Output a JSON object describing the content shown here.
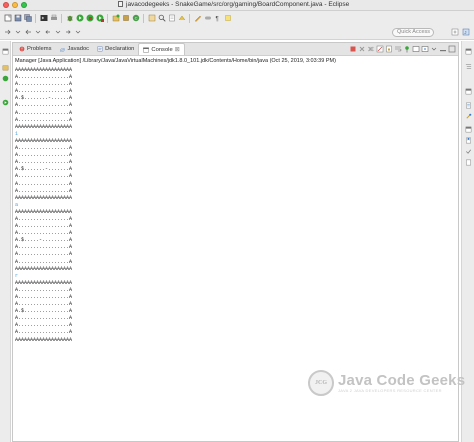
{
  "window": {
    "title": "javacodegeeks - SnakeGame/src/org/gaming/BoardComponent.java - Eclipse",
    "quick_access_placeholder": "Quick Access"
  },
  "tabs": [
    {
      "label": "Problems",
      "icon": "problems-icon"
    },
    {
      "label": "Javadoc",
      "icon": "javadoc-icon"
    },
    {
      "label": "Declaration",
      "icon": "declaration-icon"
    },
    {
      "label": "Console",
      "icon": "console-icon",
      "active": true,
      "close": "⊠"
    }
  ],
  "console": {
    "header": "Manager [Java Application] /Library/Java/JavaVirtualMachines/jdk1.8.0_101.jdk/Contents/Home/bin/java (Oct 25, 2019, 3:03:39 PM)",
    "lines": [
      "AAAAAAAAAAAAAAAAAAA",
      "A.................A",
      "A.................A",
      "A.................A",
      "A.$........-......A",
      "A.................A",
      "A.................A",
      "A.................A",
      "AAAAAAAAAAAAAAAAAAA",
      "1",
      "AAAAAAAAAAAAAAAAAAA",
      "A.................A",
      "A.................A",
      "A.................A",
      "A.$.......-.......A",
      "A.................A",
      "A.................A",
      "A.................A",
      "AAAAAAAAAAAAAAAAAAA",
      "a",
      "AAAAAAAAAAAAAAAAAAA",
      "A.................A",
      "A.................A",
      "A.................A",
      "A.$.....-.........A",
      "A.................A",
      "A.................A",
      "A.................A",
      "AAAAAAAAAAAAAAAAAAA",
      "r",
      "AAAAAAAAAAAAAAAAAAA",
      "A.................A",
      "A.................A",
      "A.................A",
      "A.$...............A",
      "A.................A",
      "A.................A",
      "A.................A",
      "AAAAAAAAAAAAAAAAAAA"
    ]
  },
  "watermark": {
    "title": "Java Code Geeks",
    "subtitle": "JAVA 2 JAVA DEVELOPERS RESOURCE CENTER",
    "logo_text": "JCG"
  }
}
